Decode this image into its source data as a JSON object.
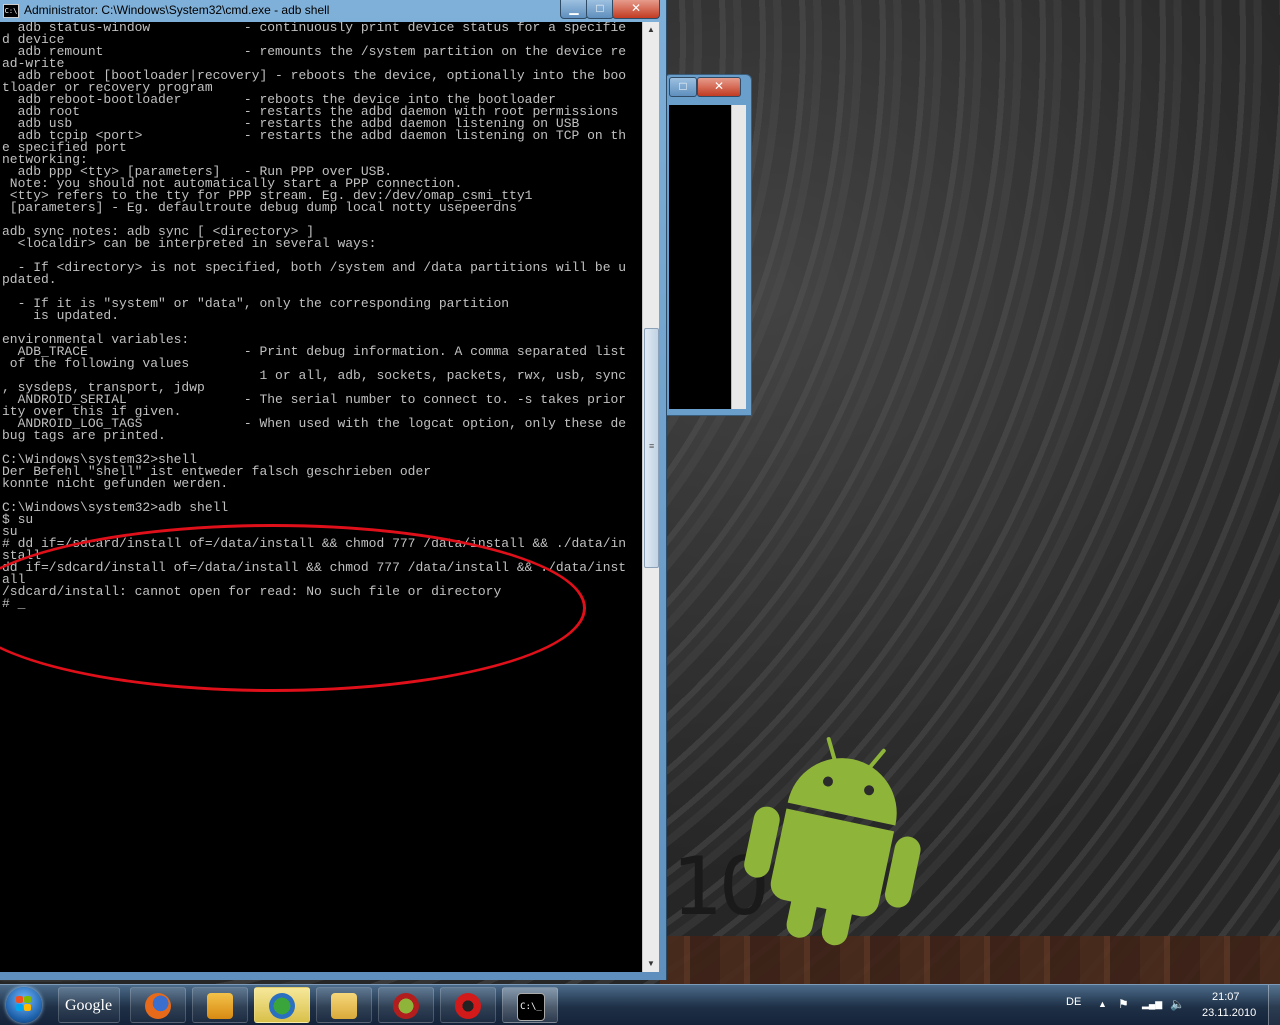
{
  "window": {
    "title": "Administrator: C:\\Windows\\System32\\cmd.exe - adb  shell",
    "icon_text": "C:\\",
    "minimize_glyph": "▁",
    "maximize_glyph": "□",
    "close_glyph": "✕"
  },
  "console": {
    "lines": [
      "  adb status-window            - continuously print device status for a specifie",
      "d device",
      "  adb remount                  - remounts the /system partition on the device re",
      "ad-write",
      "  adb reboot [bootloader|recovery] - reboots the device, optionally into the boo",
      "tloader or recovery program",
      "  adb reboot-bootloader        - reboots the device into the bootloader",
      "  adb root                     - restarts the adbd daemon with root permissions",
      "  adb usb                      - restarts the adbd daemon listening on USB",
      "  adb tcpip <port>             - restarts the adbd daemon listening on TCP on th",
      "e specified port",
      "networking:",
      "  adb ppp <tty> [parameters]   - Run PPP over USB.",
      " Note: you should not automatically start a PPP connection.",
      " <tty> refers to the tty for PPP stream. Eg. dev:/dev/omap_csmi_tty1",
      " [parameters] - Eg. defaultroute debug dump local notty usepeerdns",
      "",
      "adb sync notes: adb sync [ <directory> ]",
      "  <localdir> can be interpreted in several ways:",
      "",
      "  - If <directory> is not specified, both /system and /data partitions will be u",
      "pdated.",
      "",
      "  - If it is \"system\" or \"data\", only the corresponding partition",
      "    is updated.",
      "",
      "environmental variables:",
      "  ADB_TRACE                    - Print debug information. A comma separated list",
      " of the following values",
      "                                 1 or all, adb, sockets, packets, rwx, usb, sync",
      ", sysdeps, transport, jdwp",
      "  ANDROID_SERIAL               - The serial number to connect to. -s takes prior",
      "ity over this if given.",
      "  ANDROID_LOG_TAGS             - When used with the logcat option, only these de",
      "bug tags are printed.",
      "",
      "C:\\Windows\\system32>shell",
      "Der Befehl \"shell\" ist entweder falsch geschrieben oder",
      "konnte nicht gefunden werden.",
      "",
      "C:\\Windows\\system32>adb shell",
      "$ su",
      "su",
      "# dd if=/sdcard/install of=/data/install && chmod 777 /data/install && ./data/in",
      "stall",
      "dd if=/sdcard/install of=/data/install && chmod 777 /data/install && ./data/inst",
      "all",
      "/sdcard/install: cannot open for read: No such file or directory"
    ],
    "prompt": "# ",
    "cursor": "_"
  },
  "scrollbar": {
    "up_arrow": "▲",
    "down_arrow": "▼",
    "grip": "≡"
  },
  "background_window": {
    "maximize_glyph": "□",
    "close_glyph": "✕"
  },
  "desktop": {
    "watermark": "10"
  },
  "taskbar": {
    "google_label": "Google",
    "cmd_icon_text": "C:\\_",
    "language": "DE",
    "tray_up_arrow": "▲",
    "tray_flag": "⚑",
    "tray_network": "▂▄▆",
    "tray_volume": "🔈",
    "time": "21:07",
    "date": "23.11.2010"
  },
  "colors": {
    "console_bg": "#000000",
    "console_text": "#c0c0c0",
    "annotation_ellipse": "#e0101a",
    "android_green": "#8fb43a"
  }
}
